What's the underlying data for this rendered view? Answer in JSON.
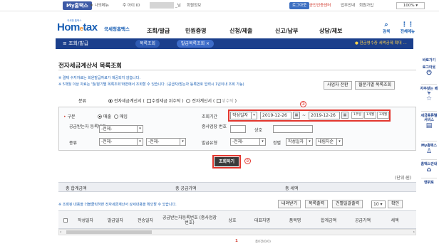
{
  "topbar": {
    "myhometax": "My홈택스",
    "my_menu": "★ 나의메뉴",
    "id_label": "주 아이 ID",
    "user_suffix": "_님",
    "member_info": "회원정보",
    "logout": "로그아웃",
    "cert_center": "공인인증센터",
    "center_info": "업무안내",
    "join": "회원가입",
    "zoom": "100%"
  },
  "header": {
    "logo_small": "국세청 홈택스",
    "logo_hom": "Hom",
    "logo_e": "e",
    "logo_tax": "tax",
    "logo_sub": "국세청홈택스",
    "gnb": [
      "조회/발급",
      "민원증명",
      "신청/제출",
      "신고/납부",
      "상담/제보"
    ],
    "search_label": "검색",
    "allmenu_label": "전체메뉴"
  },
  "nav": {
    "current": "≡  조회/발급",
    "tab1": "목록조회",
    "tab2": "발급목록조회 ×",
    "ticker": "● 현금영수증 세액공제 확대 ..."
  },
  "quick": {
    "title": "바로가기",
    "items": [
      "로그아웃",
      "자주찾는 메뉴",
      "세금종류별 서비스",
      "My홈택스",
      "홈택스안내",
      "맨위로"
    ]
  },
  "page": {
    "title": "전자세금계산서 목록조회",
    "note1": "※ 결제 수지자료는 회원발급자료가 제공되지 않습니다.",
    "note2": "※ 5개월 이상 자료는 '월/분기별 목록조회'화면에서 조회할 수 있습니다. (공급자/받는자 등록번호 입력시 1년이내 조회 가능)",
    "btn_operator_switch": "사업자 전환",
    "btn_month_list": "월분기별 목록조회"
  },
  "kind": {
    "label": "분류",
    "opt_tax": "전자세금계산서",
    "opt_tax_modify": "수정세금 위수탁",
    "opt_invoice": "전자계산서",
    "opt_invoice_modify": "위수탁"
  },
  "search": {
    "division_label": "구분",
    "sale": "매출",
    "purchase": "매입",
    "period_label": "조회기간",
    "period_type": "작성일자",
    "date_from": "2019-12-26",
    "date_sep": "~",
    "date_to": "2019-12-26",
    "btn_1month": "1주일",
    "btn_3month": "1개월",
    "btn_6month": "3개월",
    "supplier_label": "공급받는자 등록번호",
    "supplier_value": "-전체-",
    "branch_label": "종사업장 번호",
    "trade_label": "상호",
    "type_label": "종류",
    "type_value1": "-전체-",
    "type_value2": "-전체-",
    "issue_type_label": "발급유형",
    "issue_type_value": "-전체-",
    "sort_label": "정렬",
    "sort_value": "작성일자",
    "order_value": "내림차순",
    "marker1": "①",
    "marker2": "②",
    "button": "조회하기"
  },
  "result": {
    "unit": "(단위:원)",
    "total_amount": "총 합계금액",
    "total_supply": "총 공급가액",
    "total_tax": "총 세액",
    "note": "※ 조회된 내용을 더블클릭하면 전자세금계산서 상세내용을 확인할 수 있습니다.",
    "btn_download": "내려받기",
    "btn_print_list": "목록출력",
    "btn_bulk_print": "건별일괄출력",
    "page_size": "10",
    "btn_confirm": "확인",
    "columns": [
      "작성일자",
      "발급일자",
      "전송일자",
      "공급받는자등록번호 (종사업장 번호)",
      "상호",
      "대표자명",
      "품목명",
      "합계금액",
      "공급가액",
      "세액"
    ],
    "page": "1",
    "page_total": "총0건(0/0)"
  },
  "colors": {
    "navy": "#1b3f8c",
    "accent_red": "#e3362e",
    "logo_blue": "#1a5fb4"
  }
}
